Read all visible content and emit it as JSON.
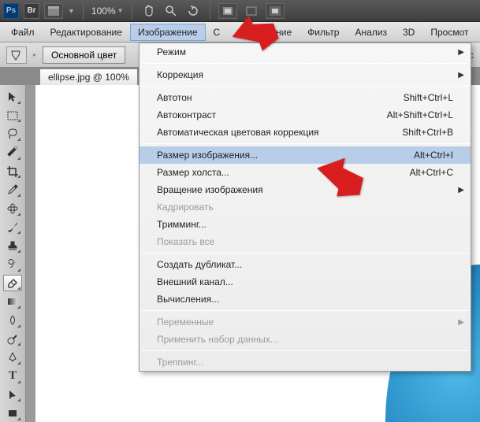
{
  "topbar": {
    "zoom": "100%"
  },
  "menubar": {
    "items": [
      "Файл",
      "Редактирование",
      "Изображение",
      "С",
      "деление",
      "Фильтр",
      "Анализ",
      "3D",
      "Просмот"
    ],
    "active_index": 2
  },
  "optbar": {
    "label": "Основной цвет",
    "trail": "пус"
  },
  "doc_tab": "ellipse.jpg @ 100%",
  "dropdown": {
    "groups": [
      [
        {
          "label": "Режим",
          "shortcut": "",
          "sub": true
        }
      ],
      [
        {
          "label": "Коррекция",
          "shortcut": "",
          "sub": true
        }
      ],
      [
        {
          "label": "Автотон",
          "shortcut": "Shift+Ctrl+L"
        },
        {
          "label": "Автоконтраст",
          "shortcut": "Alt+Shift+Ctrl+L"
        },
        {
          "label": "Автоматическая цветовая коррекция",
          "shortcut": "Shift+Ctrl+B"
        }
      ],
      [
        {
          "label": "Размер изображения...",
          "shortcut": "Alt+Ctrl+I",
          "hl": true
        },
        {
          "label": "Размер холста...",
          "shortcut": "Alt+Ctrl+C"
        },
        {
          "label": "Вращение изображения",
          "shortcut": "",
          "sub": true
        },
        {
          "label": "Кадрировать",
          "disabled": true
        },
        {
          "label": "Тримминг..."
        },
        {
          "label": "Показать все",
          "disabled": true
        }
      ],
      [
        {
          "label": "Создать дубликат..."
        },
        {
          "label": "Внешний канал..."
        },
        {
          "label": "Вычисления..."
        }
      ],
      [
        {
          "label": "Переменные",
          "disabled": true,
          "sub": true
        },
        {
          "label": "Применить набор данных...",
          "disabled": true
        }
      ],
      [
        {
          "label": "Треппинг...",
          "disabled": true
        }
      ]
    ]
  },
  "toolbox_icons": [
    "move",
    "marquee",
    "lasso",
    "wand",
    "crop",
    "eyedropper",
    "heal",
    "brush",
    "stamp",
    "history",
    "eraser",
    "gradient",
    "blur",
    "dodge",
    "pen",
    "type",
    "path",
    "shape"
  ]
}
